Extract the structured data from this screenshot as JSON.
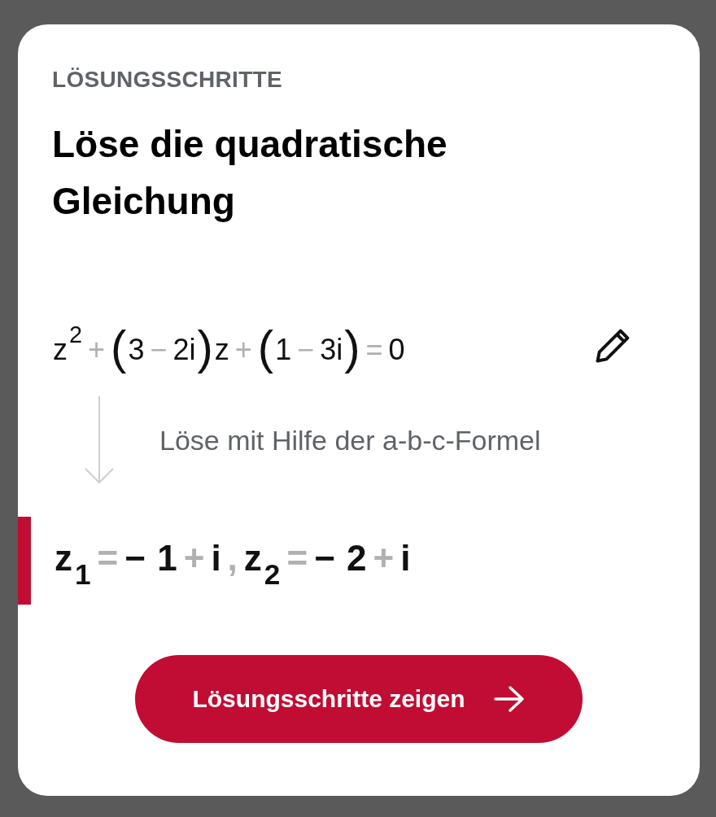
{
  "card": {
    "label": "LÖSUNGSSCHRITTE",
    "title": "Löse die quadratische Gleichung",
    "equation": [
      {
        "kind": "var",
        "text": "z"
      },
      {
        "kind": "sup",
        "text": "2"
      },
      {
        "kind": "op",
        "text": "+"
      },
      {
        "kind": "paren",
        "text": "("
      },
      {
        "kind": "var",
        "text": "3"
      },
      {
        "kind": "op",
        "text": "−"
      },
      {
        "kind": "var",
        "text": "2i"
      },
      {
        "kind": "paren",
        "text": ")"
      },
      {
        "kind": "var",
        "text": "z"
      },
      {
        "kind": "op",
        "text": "+"
      },
      {
        "kind": "paren",
        "text": "("
      },
      {
        "kind": "var",
        "text": "1"
      },
      {
        "kind": "op",
        "text": "−"
      },
      {
        "kind": "var",
        "text": "3i"
      },
      {
        "kind": "paren",
        "text": ")"
      },
      {
        "kind": "op",
        "text": "="
      },
      {
        "kind": "var",
        "text": "0"
      }
    ],
    "step": "Löse mit Hilfe der a-b-c-Formel",
    "result": [
      {
        "kind": "var",
        "text": "z"
      },
      {
        "kind": "sub",
        "text": "1"
      },
      {
        "kind": "op",
        "text": "="
      },
      {
        "kind": "var",
        "text": "− 1"
      },
      {
        "kind": "op",
        "text": "+"
      },
      {
        "kind": "var",
        "text": "i"
      },
      {
        "kind": "op",
        "text": ","
      },
      {
        "kind": "var",
        "text": "z"
      },
      {
        "kind": "sub",
        "text": "2"
      },
      {
        "kind": "op",
        "text": "="
      },
      {
        "kind": "var",
        "text": "− 2"
      },
      {
        "kind": "op",
        "text": "+"
      },
      {
        "kind": "var",
        "text": "i"
      }
    ],
    "button": "Lösungsschritte zeigen"
  }
}
